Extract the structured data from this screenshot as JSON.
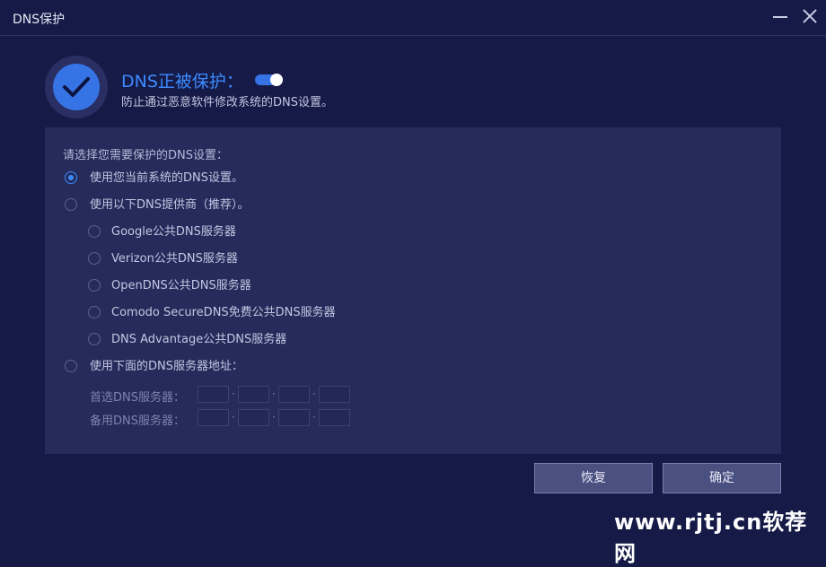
{
  "window": {
    "title": "DNS保护"
  },
  "status": {
    "title": "DNS正被保护：",
    "subtitle": "防止通过恶意软件修改系统的DNS设置。",
    "enabled": true
  },
  "panel": {
    "prompt": "请选择您需要保护的DNS设置：",
    "options": [
      {
        "label": "使用您当前系统的DNS设置。",
        "selected": true
      },
      {
        "label": "使用以下DNS提供商（推荐）。",
        "selected": false
      }
    ],
    "providers": [
      "Google公共DNS服务器",
      "Verizon公共DNS服务器",
      "OpenDNS公共DNS服务器",
      "Comodo SecureDNS免费公共DNS服务器",
      "DNS Advantage公共DNS服务器"
    ],
    "custom_option": "使用下面的DNS服务器地址：",
    "primary_label": "首选DNS服务器：",
    "secondary_label": "备用DNS服务器："
  },
  "buttons": {
    "restore": "恢复",
    "ok": "确定"
  },
  "watermark": "www.rjtj.cn软荐网"
}
